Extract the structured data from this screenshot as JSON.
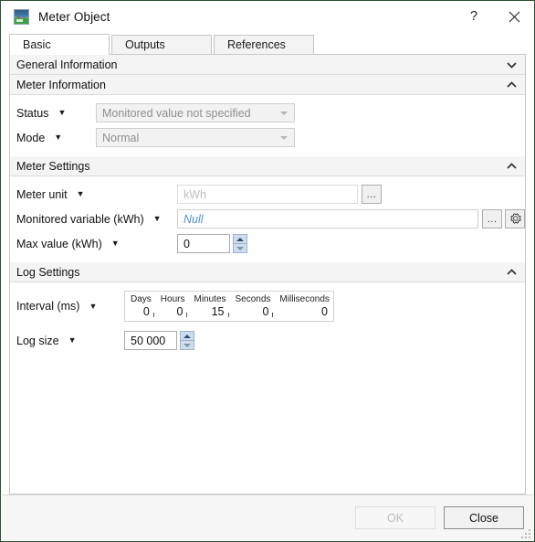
{
  "window": {
    "title": "Meter Object",
    "icon": "landscape-photo-icon",
    "help_label": "?",
    "close_label": "close-icon"
  },
  "tabs": [
    {
      "label": "Basic",
      "active": true
    },
    {
      "label": "Outputs",
      "active": false
    },
    {
      "label": "References",
      "active": false
    }
  ],
  "groups": {
    "general_information": {
      "title": "General Information",
      "state": "collapsed",
      "chevron": "chevron-down-icon"
    },
    "meter_information": {
      "title": "Meter Information",
      "state": "expanded",
      "chevron": "chevron-up-icon",
      "status": {
        "label": "Status",
        "caret": "▼",
        "value": "Monitored value not specified",
        "disabled": true
      },
      "mode": {
        "label": "Mode",
        "caret": "▼",
        "value": "Normal",
        "disabled": true
      }
    },
    "meter_settings": {
      "title": "Meter Settings",
      "state": "expanded",
      "chevron": "chevron-up-icon",
      "meter_unit": {
        "label": "Meter unit",
        "caret": "▼",
        "value": "",
        "placeholder": "kWh",
        "browse_label": "..."
      },
      "monitored_variable": {
        "label": "Monitored variable (kWh)",
        "caret": "▼",
        "value": "Null",
        "browse_label": "...",
        "settings_icon": "gear-icon"
      },
      "max_value": {
        "label": "Max value (kWh)",
        "caret": "▼",
        "value": "0"
      }
    },
    "log_settings": {
      "title": "Log Settings",
      "state": "expanded",
      "chevron": "chevron-up-icon",
      "interval": {
        "label": "Interval (ms)",
        "caret": "▼",
        "columns": [
          {
            "header": "Days",
            "value": "0"
          },
          {
            "header": "Hours",
            "value": "0"
          },
          {
            "header": "Minutes",
            "value": "15"
          },
          {
            "header": "Seconds",
            "value": "0"
          },
          {
            "header": "Milliseconds",
            "value": "0"
          }
        ]
      },
      "log_size": {
        "label": "Log size",
        "caret": "▼",
        "value": "50 000"
      }
    }
  },
  "footer": {
    "ok_label": "OK",
    "ok_disabled": true,
    "close_label": "Close",
    "grip": "resize-grip"
  },
  "colors": {
    "window_border": "#2f4f33",
    "group_header_bg": "#f4f4f4",
    "null_text": "#4f90cf",
    "spinner_bg": "#cfdcec"
  }
}
